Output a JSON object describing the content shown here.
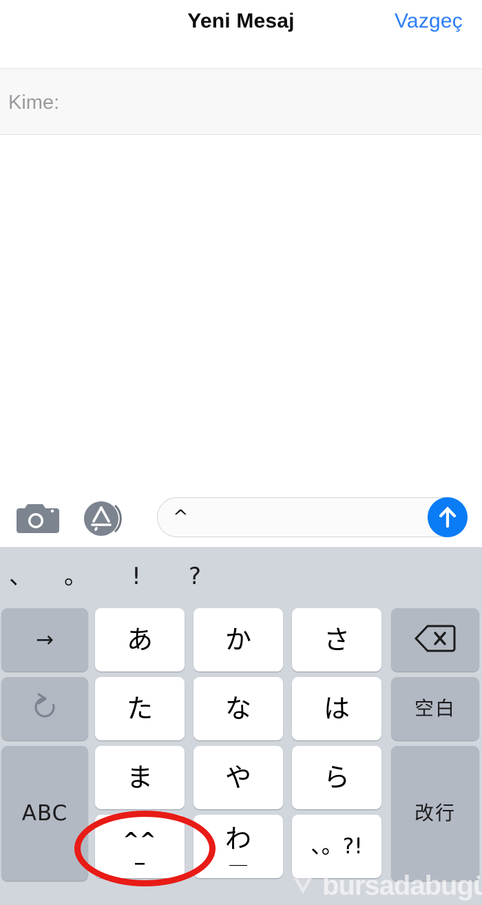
{
  "navbar": {
    "title": "Yeni Mesaj",
    "cancel_label": "Vazgeç",
    "cancel_color": "#2d7ef7"
  },
  "recipient": {
    "label": "Kime:",
    "value": "",
    "placeholder": ""
  },
  "input_toolbar": {
    "camera_icon": "camera-icon",
    "appstore_icon": "app-store-icon",
    "text_value": "^",
    "placeholder": "",
    "send_icon": "send-arrow-up-icon",
    "send_color": "#0a7cf5"
  },
  "keyboard": {
    "background_color": "#d1d5dc",
    "suggestions": [
      "、",
      "。",
      "!",
      "?"
    ],
    "rows": [
      {
        "keys": [
          {
            "name": "key-arrow-right",
            "label": "→",
            "style": "gray",
            "glyph_class": "glyph-sm"
          },
          {
            "name": "key-a-row",
            "label": "あ",
            "style": "white",
            "glyph_class": "glyph"
          },
          {
            "name": "key-ka-row",
            "label": "か",
            "style": "white",
            "glyph_class": "glyph"
          },
          {
            "name": "key-sa-row",
            "label": "さ",
            "style": "white",
            "glyph_class": "glyph"
          },
          {
            "name": "key-backspace",
            "label": "",
            "style": "gray",
            "glyph_class": "glyph"
          }
        ]
      },
      {
        "keys": [
          {
            "name": "key-undo",
            "label": "",
            "style": "gray",
            "glyph_class": "glyph"
          },
          {
            "name": "key-ta-row",
            "label": "た",
            "style": "white",
            "glyph_class": "glyph"
          },
          {
            "name": "key-na-row",
            "label": "な",
            "style": "white",
            "glyph_class": "glyph"
          },
          {
            "name": "key-ha-row",
            "label": "は",
            "style": "white",
            "glyph_class": "glyph"
          },
          {
            "name": "key-space",
            "label": "空白",
            "style": "gray",
            "glyph_class": "glyph-cjk"
          }
        ]
      },
      {
        "keys": [
          {
            "name": "key-abc",
            "label": "ABC",
            "style": "gray",
            "glyph_class": "glyph-abc"
          },
          {
            "name": "key-ma-row",
            "label": "ま",
            "style": "white",
            "glyph_class": "glyph"
          },
          {
            "name": "key-ya-row",
            "label": "や",
            "style": "white",
            "glyph_class": "glyph"
          },
          {
            "name": "key-ra-row",
            "label": "ら",
            "style": "white",
            "glyph_class": "glyph"
          },
          {
            "name": "key-return",
            "label": "改行",
            "style": "gray",
            "glyph_class": "glyph-cjk"
          }
        ]
      },
      {
        "keys": [
          {
            "name": "key-emoticon",
            "label_top": "^^",
            "label_bottom": "_",
            "style": "white"
          },
          {
            "name": "key-wa-row",
            "label_top": "わ",
            "label_bottom": "＿",
            "style": "white"
          },
          {
            "name": "key-punctuation",
            "label": "、。?!",
            "style": "white",
            "glyph_class": "glyph-sm"
          }
        ]
      }
    ]
  },
  "annotation": {
    "type": "red-ellipse-highlight",
    "target": "key-emoticon",
    "color": "#e81b16"
  },
  "watermark": {
    "text": "bursadabügün",
    "display_text": "bursadabugün"
  }
}
